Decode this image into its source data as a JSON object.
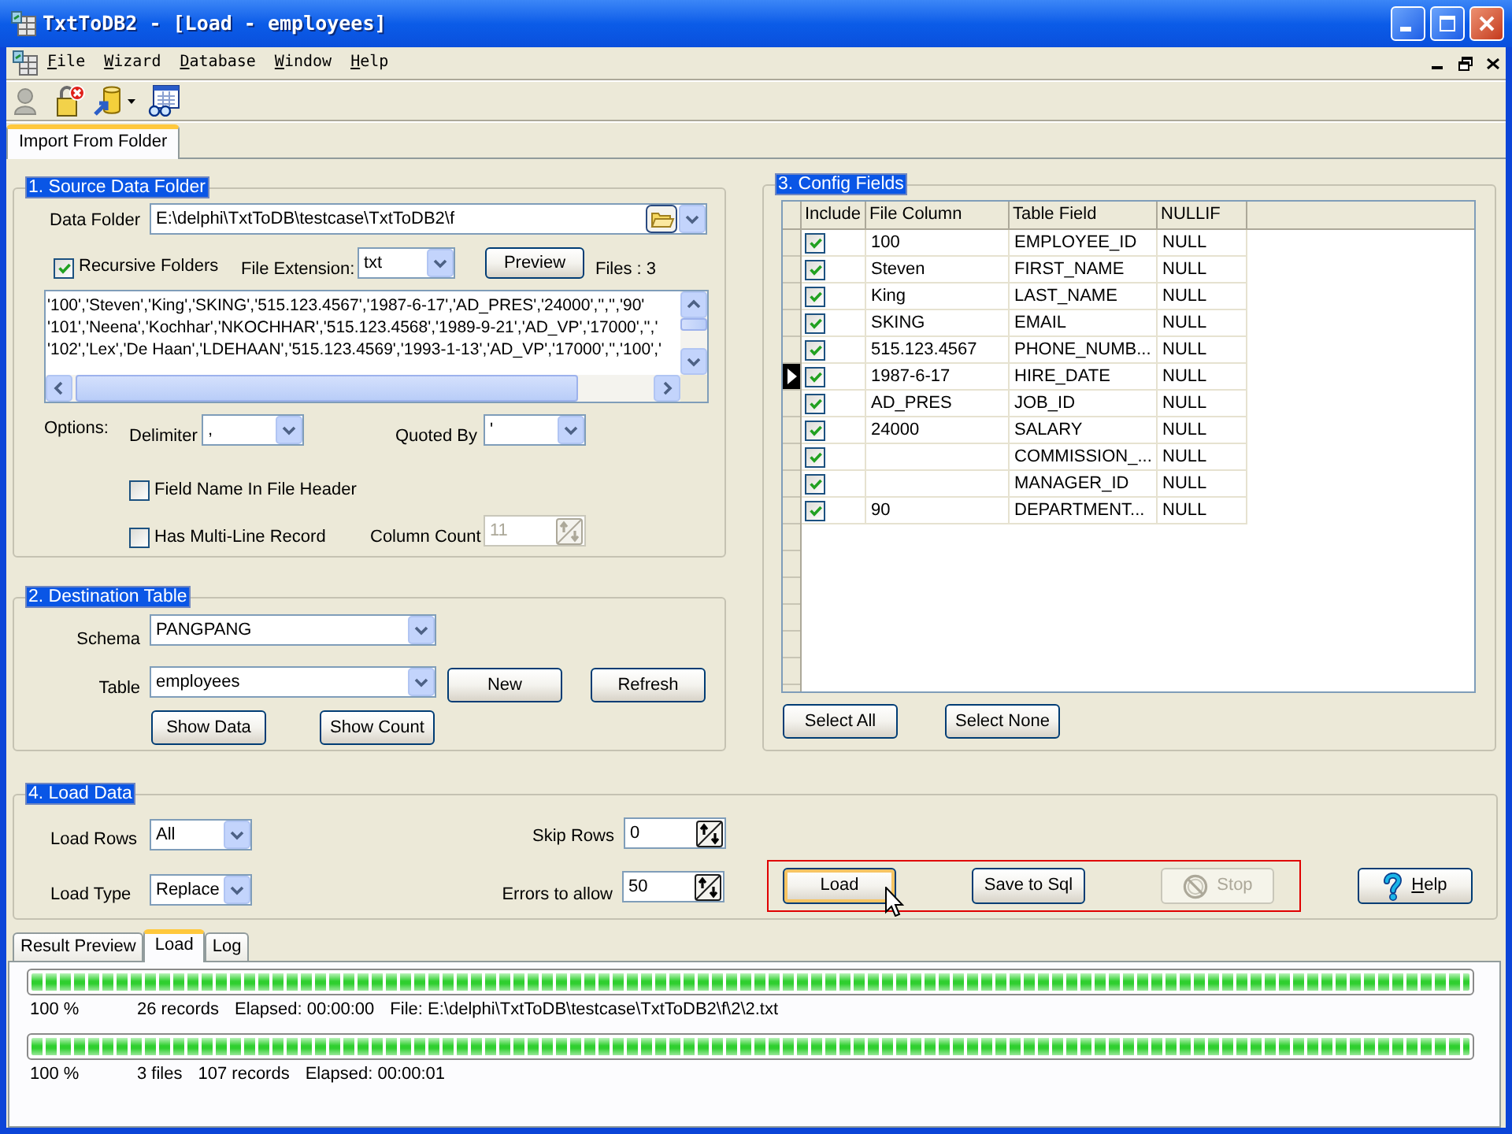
{
  "window": {
    "title": "TxtToDB2 - [Load - employees]"
  },
  "menu": [
    {
      "mnemonic": "F",
      "rest": "ile"
    },
    {
      "mnemonic": "W",
      "rest": "izard"
    },
    {
      "mnemonic": "D",
      "rest": "atabase"
    },
    {
      "mnemonic": "W",
      "rest": "indow"
    },
    {
      "mnemonic": "H",
      "rest": "elp"
    }
  ],
  "tabs": [
    {
      "label": "Import From Folder",
      "selected": true
    }
  ],
  "source": {
    "title": "1. Source Data Folder",
    "data_folder": {
      "label": "Data Folder",
      "value": "E:\\delphi\\TxtToDB\\testcase\\TxtToDB2\\f"
    },
    "recursive": {
      "label": "Recursive Folders",
      "checked": true
    },
    "file_extension": {
      "label": "File Extension:",
      "value": "txt"
    },
    "preview_button": "Preview",
    "files": "Files : 3",
    "preview_lines": [
      "'100','Steven','King','SKING','515.123.4567','1987-6-17','AD_PRES','24000','','','90'",
      "'101','Neena','Kochhar','NKOCHHAR','515.123.4568','1989-9-21','AD_VP','17000','','",
      "'102','Lex','De Haan','LDEHAAN','515.123.4569','1993-1-13','AD_VP','17000','','100','"
    ],
    "options_label": "Options:",
    "delimiter": {
      "label": "Delimiter",
      "value": ","
    },
    "quoted_by": {
      "label": "Quoted By",
      "value": "'"
    },
    "field_name_in_header": {
      "label": "Field Name In File Header",
      "checked": false
    },
    "multi_line": {
      "label": "Has Multi-Line Record",
      "checked": false
    },
    "column_count": {
      "label": "Column Count",
      "value": "11",
      "disabled": true
    }
  },
  "destination": {
    "title": "2. Destination Table",
    "schema": {
      "label": "Schema",
      "value": "PANGPANG"
    },
    "table": {
      "label": "Table",
      "value": "employees"
    },
    "buttons": [
      "New",
      "Refresh",
      "Show Data",
      "Show Count"
    ]
  },
  "config": {
    "title": "3. Config Fields",
    "columns": [
      "Include",
      "File Column",
      "Table Field",
      "NULLIF"
    ],
    "rows": [
      {
        "include": true,
        "file_column": "100",
        "table_field": "EMPLOYEE_ID",
        "nullif": "NULL",
        "selected": false
      },
      {
        "include": true,
        "file_column": "Steven",
        "table_field": "FIRST_NAME",
        "nullif": "NULL",
        "selected": false
      },
      {
        "include": true,
        "file_column": "King",
        "table_field": "LAST_NAME",
        "nullif": "NULL",
        "selected": false
      },
      {
        "include": true,
        "file_column": "SKING",
        "table_field": "EMAIL",
        "nullif": "NULL",
        "selected": false
      },
      {
        "include": true,
        "file_column": "515.123.4567",
        "table_field": "PHONE_NUMB...",
        "nullif": "NULL",
        "selected": false
      },
      {
        "include": true,
        "file_column": "1987-6-17",
        "table_field": "HIRE_DATE",
        "nullif": "NULL",
        "selected": true
      },
      {
        "include": true,
        "file_column": "AD_PRES",
        "table_field": "JOB_ID",
        "nullif": "NULL",
        "selected": false
      },
      {
        "include": true,
        "file_column": "24000",
        "table_field": "SALARY",
        "nullif": "NULL",
        "selected": false
      },
      {
        "include": true,
        "table_field": "COMMISSION_...",
        "nullif": "NULL",
        "selected": false
      },
      {
        "include": true,
        "table_field": "MANAGER_ID",
        "nullif": "NULL",
        "selected": false
      },
      {
        "include": true,
        "file_column": "90",
        "table_field": "DEPARTMENT...",
        "nullif": "NULL",
        "selected": false
      }
    ],
    "buttons": [
      "Select All",
      "Select None"
    ]
  },
  "load": {
    "title": "4. Load Data",
    "load_rows": {
      "label": "Load Rows",
      "value": "All"
    },
    "load_type": {
      "label": "Load Type",
      "value": "Replace"
    },
    "skip_rows": {
      "label": "Skip Rows",
      "value": "0"
    },
    "errors_to_allow": {
      "label": "Errors to allow",
      "value": "50"
    },
    "action_group": {
      "highlighted": true,
      "buttons": [
        {
          "label": "Load",
          "kind": "text",
          "focused": true,
          "disabled": false
        },
        {
          "label": "Save to Sql",
          "kind": "text",
          "focused": false,
          "disabled": false
        },
        {
          "label": "Stop",
          "kind": "icon",
          "focused": false,
          "disabled": true
        }
      ]
    },
    "help_button": {
      "mnemonic": "H",
      "rest": "elp"
    }
  },
  "result_tabs": [
    {
      "label": "Result Preview",
      "selected": false
    },
    {
      "label": "Load",
      "selected": true
    },
    {
      "label": "Log",
      "selected": false
    }
  ],
  "progress": [
    {
      "level": 1,
      "texts": [
        "100 %",
        "26 records",
        "Elapsed: 00:00:00",
        "File: E:\\delphi\\TxtToDB\\testcase\\TxtToDB2\\f\\2\\2.txt"
      ]
    },
    {
      "level": 1,
      "texts": [
        "100 %",
        "3 files",
        "107 records",
        "Elapsed: 00:00:01"
      ]
    }
  ]
}
